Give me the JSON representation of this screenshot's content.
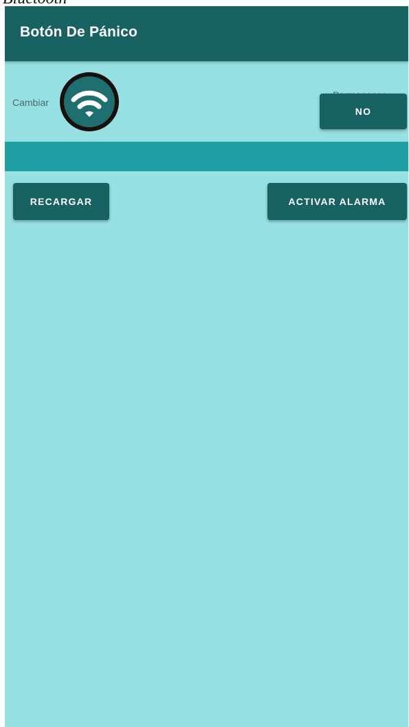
{
  "caption": "Bluetooth",
  "appbar": {
    "title": "Botón De Pánico"
  },
  "controls": {
    "cambiar_label": "Cambiar",
    "wifi_icon": "wifi-icon",
    "permanecer_label": "Permanecer",
    "permanecer_value": "NO"
  },
  "actions": {
    "recargar_label": "RECARGAR",
    "activar_label": "ACTIVAR ALARMA"
  },
  "colors": {
    "appbar": "#196264",
    "background": "#96e0e3",
    "strip": "#229fa3",
    "button": "#196264"
  }
}
